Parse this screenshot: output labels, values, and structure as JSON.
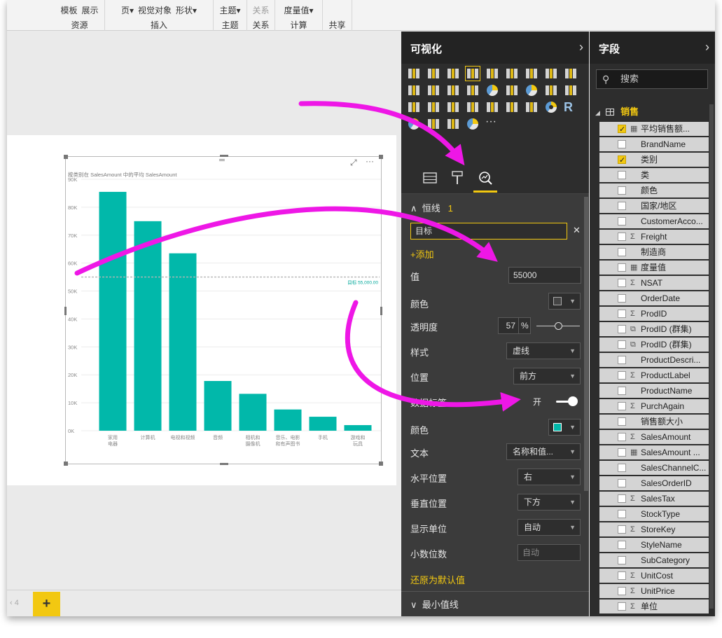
{
  "ribbon": {
    "groups": [
      {
        "items": [
          "模板",
          "展示"
        ],
        "label": "资源"
      },
      {
        "items": [
          "页▾",
          "视觉对象",
          "形状▾"
        ],
        "label": "插入"
      },
      {
        "items": [
          "主题▾"
        ],
        "label": "主题"
      },
      {
        "items": [
          "关系"
        ],
        "label": "关系"
      },
      {
        "items": [
          "度量值▾"
        ],
        "label": "计算"
      },
      {
        "items": [],
        "label": "共享"
      }
    ]
  },
  "chart": {
    "title": "按类别在 SalesAmount 中的平均 SalesAmount",
    "target_label": "目标 55,000.00",
    "more_icon": "···"
  },
  "chart_data": {
    "type": "bar",
    "title": "按类别在 SalesAmount 中的平均 SalesAmount",
    "categories": [
      "家用电器",
      "计算机",
      "电视和视频",
      "音频",
      "相机和摄像机",
      "音乐、电影和有声图书",
      "手机",
      "游戏和玩具"
    ],
    "category_lines": [
      [
        "家用",
        "电器"
      ],
      [
        "计算机"
      ],
      [
        "电视和视频"
      ],
      [
        "音频"
      ],
      [
        "相机和",
        "摄像机"
      ],
      [
        "音乐、电影",
        "和有声图书"
      ],
      [
        "手机"
      ],
      [
        "游戏和",
        "玩具"
      ]
    ],
    "values": [
      85500,
      75000,
      63500,
      17800,
      13200,
      7600,
      5000,
      2000
    ],
    "ylim": [
      0,
      90000
    ],
    "yticks": [
      "0K",
      "10K",
      "20K",
      "30K",
      "40K",
      "50K",
      "60K",
      "70K",
      "80K",
      "90K"
    ],
    "reference_line": {
      "name": "目标",
      "value": 55000,
      "label": "目标 55,000.00"
    },
    "bar_color": "#01b8aa",
    "grid": true
  },
  "pages": {
    "nav": "‹ 4",
    "add": "+"
  },
  "viz": {
    "title": "可视化",
    "collapse": "›",
    "section_title": "恒线",
    "section_count": "1",
    "line_name": "目标",
    "clear": "✕",
    "add": "+添加",
    "value_label": "值",
    "value": "55000",
    "color_label": "颜色",
    "transparency_label": "透明度",
    "transparency_value": "57",
    "transparency_unit": "%",
    "style_label": "样式",
    "style_value": "虚线",
    "position_label": "位置",
    "position_value": "前方",
    "data_label_label": "数据标签",
    "data_label_state": "开",
    "label_color_label": "颜色",
    "text_label": "文本",
    "text_value": "名称和值...",
    "hpos_label": "水平位置",
    "hpos_value": "右",
    "vpos_label": "垂直位置",
    "vpos_value": "下方",
    "units_label": "显示单位",
    "units_value": "自动",
    "decimals_label": "小数位数",
    "decimals_placeholder": "自动",
    "reset": "还原为默认值",
    "min_line": "最小值线",
    "line_color": "#444444",
    "label_color": "#01b8aa"
  },
  "fields": {
    "title": "字段",
    "collapse": "›",
    "search_placeholder": "搜索",
    "table": "销售",
    "items": [
      {
        "name": "平均销售额...",
        "checked": true,
        "icon": "calc"
      },
      {
        "name": "BrandName",
        "checked": false,
        "icon": ""
      },
      {
        "name": "类别",
        "checked": true,
        "icon": ""
      },
      {
        "name": "类",
        "checked": false,
        "icon": ""
      },
      {
        "name": "颜色",
        "checked": false,
        "icon": ""
      },
      {
        "name": "国家/地区",
        "checked": false,
        "icon": ""
      },
      {
        "name": "CustomerAcco...",
        "checked": false,
        "icon": ""
      },
      {
        "name": "Freight",
        "checked": false,
        "icon": "sum"
      },
      {
        "name": "制造商",
        "checked": false,
        "icon": ""
      },
      {
        "name": "度量值",
        "checked": false,
        "icon": "calc"
      },
      {
        "name": "NSAT",
        "checked": false,
        "icon": "sum"
      },
      {
        "name": "OrderDate",
        "checked": false,
        "icon": ""
      },
      {
        "name": "ProdID",
        "checked": false,
        "icon": "sum"
      },
      {
        "name": "ProdID (群集)",
        "checked": false,
        "icon": "group"
      },
      {
        "name": "ProdID (群集)",
        "checked": false,
        "icon": "group"
      },
      {
        "name": "ProductDescri...",
        "checked": false,
        "icon": ""
      },
      {
        "name": "ProductLabel",
        "checked": false,
        "icon": "sum"
      },
      {
        "name": "ProductName",
        "checked": false,
        "icon": ""
      },
      {
        "name": "PurchAgain",
        "checked": false,
        "icon": "sum"
      },
      {
        "name": "销售额大小",
        "checked": false,
        "icon": ""
      },
      {
        "name": "SalesAmount",
        "checked": false,
        "icon": "sum"
      },
      {
        "name": "SalesAmount ...",
        "checked": false,
        "icon": "calc"
      },
      {
        "name": "SalesChannelC...",
        "checked": false,
        "icon": ""
      },
      {
        "name": "SalesOrderID",
        "checked": false,
        "icon": ""
      },
      {
        "name": "SalesTax",
        "checked": false,
        "icon": "sum"
      },
      {
        "name": "StockType",
        "checked": false,
        "icon": ""
      },
      {
        "name": "StoreKey",
        "checked": false,
        "icon": "sum"
      },
      {
        "name": "StyleName",
        "checked": false,
        "icon": ""
      },
      {
        "name": "SubCategory",
        "checked": false,
        "icon": ""
      },
      {
        "name": "UnitCost",
        "checked": false,
        "icon": "sum"
      },
      {
        "name": "UnitPrice",
        "checked": false,
        "icon": "sum"
      },
      {
        "name": "单位",
        "checked": false,
        "icon": "sum"
      }
    ]
  },
  "colors": {
    "accent": "#f2c811",
    "arrow": "#ee17e6",
    "bar": "#01b8aa"
  }
}
